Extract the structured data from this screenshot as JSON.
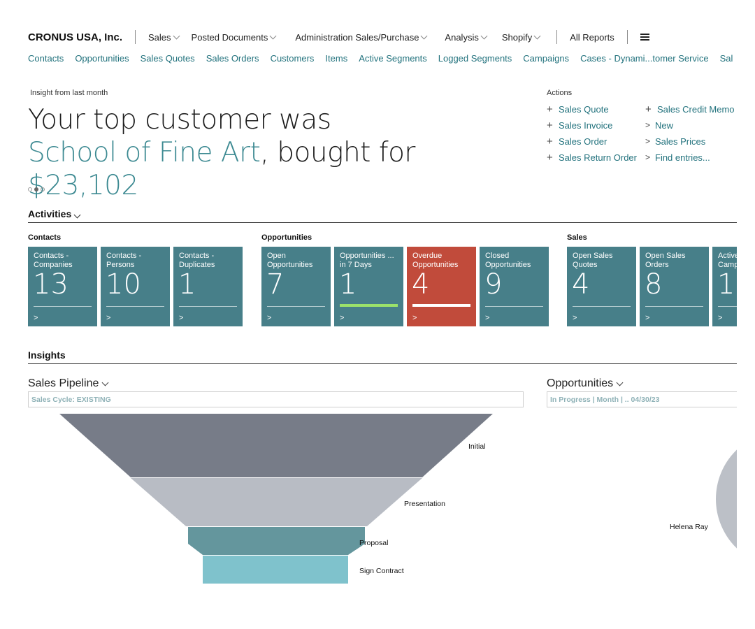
{
  "nav": {
    "company": "CRONUS USA, Inc.",
    "menus": [
      "Sales",
      "Posted Documents",
      "Administration Sales/Purchase",
      "Analysis",
      "Shopify"
    ],
    "all_reports": "All Reports"
  },
  "subnav": [
    "Contacts",
    "Opportunities",
    "Sales Quotes",
    "Sales Orders",
    "Customers",
    "Items",
    "Active Segments",
    "Logged Segments",
    "Campaigns",
    "Cases - Dynami...tomer Service",
    "Sal"
  ],
  "insight": {
    "caption": "Insight from last month",
    "part1": "Your top customer was ",
    "customer": "School of Fine Art",
    "part2": ", bought for ",
    "amount": "$23,102"
  },
  "actions": {
    "caption": "Actions",
    "left": [
      {
        "symbol": "+",
        "label": "Sales Quote"
      },
      {
        "symbol": "+",
        "label": "Sales Invoice"
      },
      {
        "symbol": "+",
        "label": "Sales Order"
      },
      {
        "symbol": "+",
        "label": "Sales Return Order"
      }
    ],
    "right": [
      {
        "symbol": "+",
        "label": "Sales Credit Memo"
      },
      {
        "symbol": ">",
        "label": "New"
      },
      {
        "symbol": ">",
        "label": "Sales Prices"
      },
      {
        "symbol": ">",
        "label": "Find entries..."
      }
    ]
  },
  "activities": {
    "title": "Activities",
    "groups": {
      "contacts": {
        "title": "Contacts",
        "tiles": [
          {
            "label": "Contacts - Companies",
            "value": "13"
          },
          {
            "label": "Contacts - Persons",
            "value": "10"
          },
          {
            "label": "Contacts - Duplicates",
            "value": "1"
          }
        ]
      },
      "opportunities": {
        "title": "Opportunities",
        "tiles": [
          {
            "label": "Open Opportunities",
            "value": "7"
          },
          {
            "label": "Opportunities ... in 7 Days",
            "value": "1",
            "indicator": "#9be26a"
          },
          {
            "label": "Overdue Opportunities",
            "value": "4",
            "indicator": "#ffffff",
            "status_color": "#c14b3b"
          },
          {
            "label": "Closed Opportunities",
            "value": "9"
          }
        ]
      },
      "sales": {
        "title": "Sales",
        "tiles": [
          {
            "label": "Open Sales Quotes",
            "value": "4"
          },
          {
            "label": "Open Sales Orders",
            "value": "8"
          },
          {
            "label": "Active Camp",
            "value": "1"
          }
        ]
      }
    },
    "tile_arrow": ">"
  },
  "insights": {
    "title": "Insights",
    "pipeline": {
      "title": "Sales Pipeline",
      "filter": "Sales Cycle: EXISTING"
    },
    "opportunities": {
      "title": "Opportunities",
      "filter": "In Progress | Month |  .. 04/30/23",
      "slice_label": "Helena Ray"
    }
  },
  "chart_data": [
    {
      "type": "funnel",
      "title": "Sales Pipeline",
      "categories": [
        "Initial",
        "Presentation",
        "Proposal",
        "Sign Contract"
      ],
      "colors": [
        "#777c88",
        "#b8bcc4",
        "#64969d",
        "#7fc2cc"
      ]
    },
    {
      "type": "pie",
      "title": "Opportunities",
      "categories": [
        "Helena Ray"
      ],
      "colors": [
        "#bcc0c7"
      ]
    }
  ]
}
